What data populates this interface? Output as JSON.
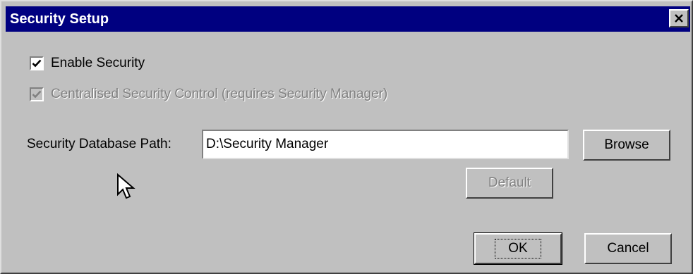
{
  "window": {
    "title": "Security Setup"
  },
  "options": {
    "enable_security": {
      "label": "Enable Security",
      "checked": true,
      "enabled": true
    },
    "centralised_control": {
      "label": "Centralised Security Control (requires Security Manager)",
      "checked": true,
      "enabled": false
    }
  },
  "database": {
    "label": "Security Database Path:",
    "value": "D:\\Security Manager"
  },
  "buttons": {
    "browse": "Browse",
    "default": "Default",
    "ok": "OK",
    "cancel": "Cancel"
  },
  "icons": {
    "close": "close-icon",
    "check": "check-icon",
    "cursor": "mouse-pointer-icon"
  },
  "colors": {
    "title_bar": "#000080",
    "dialog_face": "#c0c0c0",
    "disabled_text": "#808080"
  }
}
